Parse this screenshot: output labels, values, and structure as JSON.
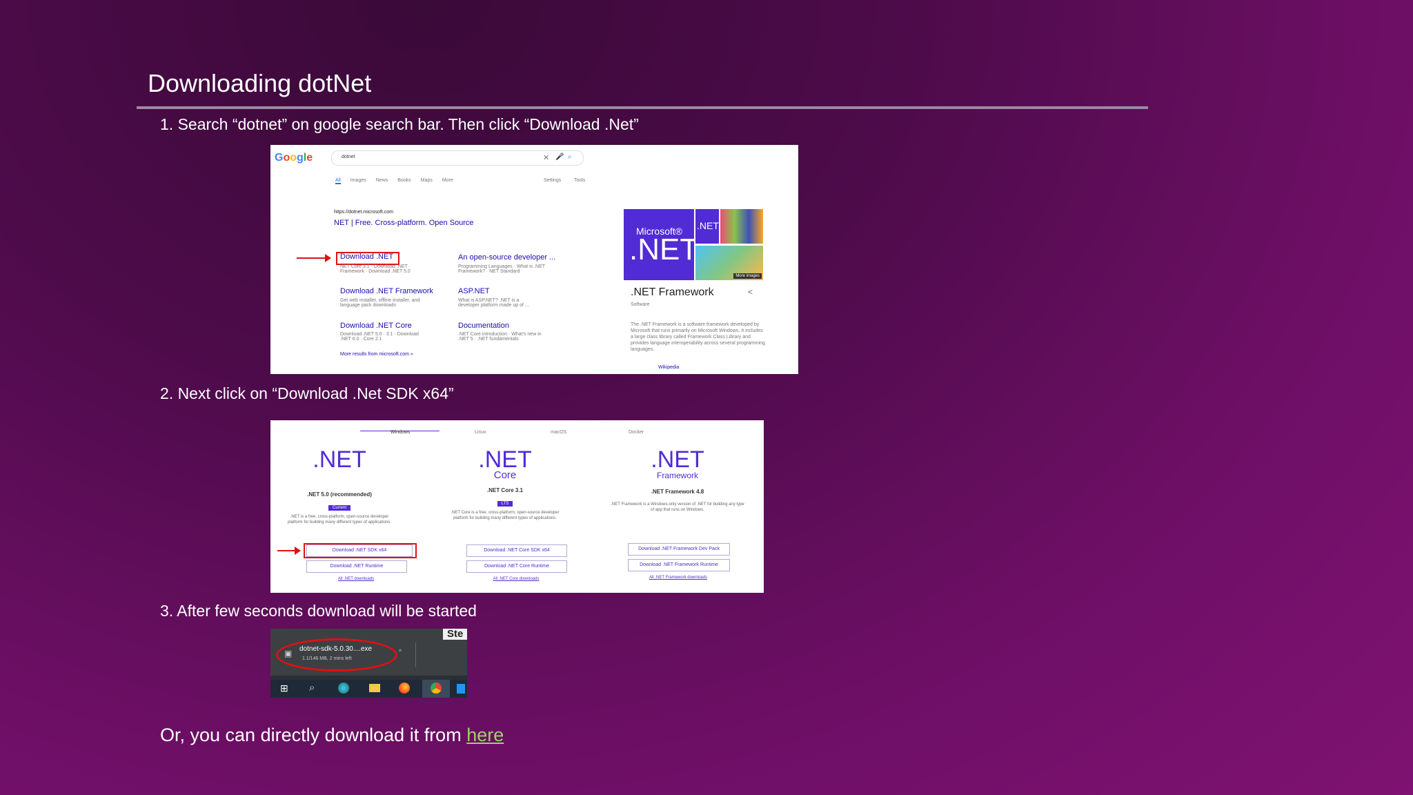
{
  "slide": {
    "title": "Downloading dotNet",
    "step1": "1. Search “dotnet” on google search bar. Then click “Download .Net”",
    "step2": "2. Next click on “Download .Net SDK x64”",
    "step3": "3. After few seconds download will be started",
    "footer_prefix": "Or, you can directly download it from ",
    "footer_link": "here"
  },
  "google": {
    "query": "dotnet",
    "tabs": [
      "All",
      "Images",
      "News",
      "Books",
      "Maps",
      "More"
    ],
    "tools": [
      "Settings",
      "Tools"
    ],
    "result_url": "https://dotnet.microsoft.com",
    "result_title": "NET | Free. Cross-platform. Open Source",
    "sitelinks": [
      {
        "title": "Download .NET",
        "desc": "NET Core 3.1 · Download .NET Framework · Download .NET 5.0"
      },
      {
        "title": "An open-source developer ...",
        "desc": "Programming Languages · What is .NET Framework? · NET Standard"
      },
      {
        "title": "Download .NET Framework",
        "desc": "Get web installer, offline installer, and language pack downloads"
      },
      {
        "title": "ASP.NET",
        "desc": "What is ASP.NET? .NET is a developer platform made up of ..."
      },
      {
        "title": "Download .NET Core",
        "desc": "Download .NET 5.0 · 3.1 · Download .NET 6.0 · Core 2.1"
      },
      {
        "title": "Documentation",
        "desc": ".NET Core introduction · What's new in .NET 5 · .NET fundamentals"
      }
    ],
    "more_results": "More results from microsoft.com »",
    "panel_logo_top": "Microsoft®",
    "panel_logo": ".NET",
    "panel_logo_small": ".NET",
    "panel_title": ".NET Framework",
    "panel_subtitle": "Software",
    "panel_desc": "The .NET Framework is a software framework developed by Microsoft that runs primarily on Microsoft Windows. It includes a large class library called Framework Class Library and provides language interoperability across several programming languages.",
    "panel_source": "Wikipedia",
    "more_images": "More images"
  },
  "dotnet": {
    "os_tabs": [
      "Windows",
      "Linux",
      "macOS",
      "Docker"
    ],
    "columns": [
      {
        "logo": ".NET",
        "sub": "",
        "version": ".NET 5.0 (recommended)",
        "badge": "Current",
        "desc": ".NET is a free, cross-platform, open-source developer platform for building many different types of applications.",
        "buttons": [
          "Download .NET SDK x64",
          "Download .NET Runtime"
        ],
        "all": "All .NET downloads"
      },
      {
        "logo": ".NET",
        "sub": "Core",
        "version": ".NET Core 3.1",
        "badge": "LTS",
        "desc": ".NET Core is a free, cross-platform, open-source developer platform for building many different types of applications.",
        "buttons": [
          "Download .NET Core SDK x64",
          "Download .NET Core Runtime"
        ],
        "all": "All .NET Core downloads"
      },
      {
        "logo": ".NET",
        "sub": "Framework",
        "version": ".NET Framework 4.8",
        "badge": "",
        "desc": ".NET Framework is a Windows-only version of .NET for building any type of app that runs on Windows.",
        "buttons": [
          "Download .NET Framework Dev Pack",
          "Download .NET Framework Runtime"
        ],
        "all": "All .NET Framework downloads"
      }
    ]
  },
  "download": {
    "corner": "Ste",
    "filename": "dotnet-sdk-5.0.30....exe",
    "progress": "1.1/146 MB, 2 mins left"
  }
}
